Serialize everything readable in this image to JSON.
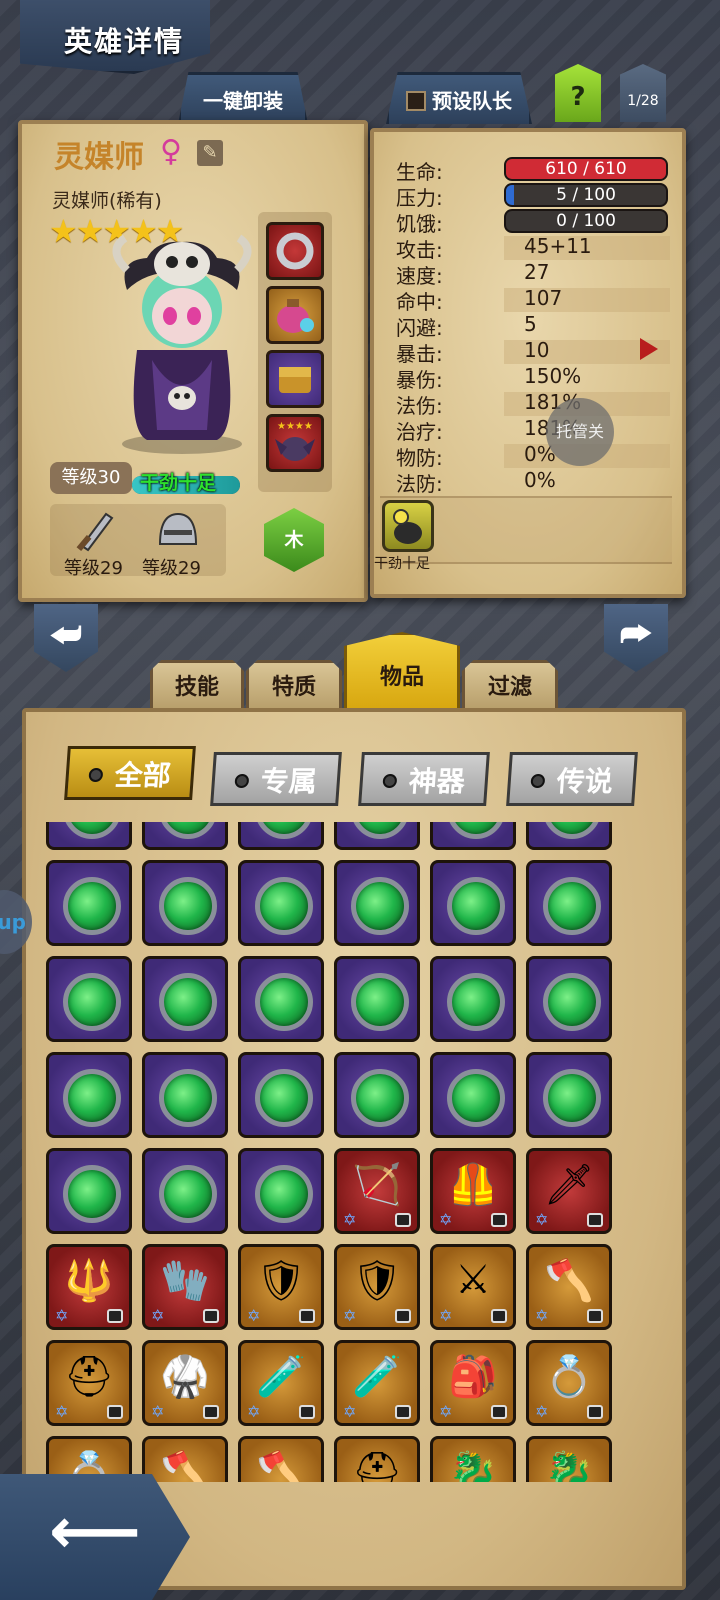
{
  "header": {
    "title": "英雄详情"
  },
  "top_tabs": {
    "unequip_all": "一键卸装",
    "preset_captain": "预设队长",
    "help": "?",
    "page_indicator": "1/28"
  },
  "hero": {
    "name": "灵媒师",
    "gender_symbol": "♀",
    "class": "灵媒师(稀有)",
    "stars": 5,
    "stars_text": "★★★★★",
    "level": "等级30",
    "mood": "干劲十足",
    "mood_level": 1.0,
    "weapon_level": "等级29",
    "armor_level": "等级29",
    "element": "木",
    "equipment_slots": [
      "ring",
      "potion-bag",
      "chest",
      "bat-pet"
    ]
  },
  "stats": {
    "hp_label": "生命:",
    "hp_value": "610 / 610",
    "hp_fraction": 1.0,
    "stress_label": "压力:",
    "stress_value": "5 / 100",
    "stress_fraction": 0.05,
    "hunger_label": "饥饿:",
    "hunger_value": "0 / 100",
    "hunger_fraction": 0.0,
    "rows": [
      {
        "label": "攻击:",
        "value": "45+11"
      },
      {
        "label": "速度:",
        "value": "27"
      },
      {
        "label": "命中:",
        "value": "107"
      },
      {
        "label": "闪避:",
        "value": "5"
      },
      {
        "label": "暴击:",
        "value": "10"
      },
      {
        "label": "暴伤:",
        "value": "150%"
      },
      {
        "label": "法伤:",
        "value": "181%"
      },
      {
        "label": "治疗:",
        "value": "181%"
      },
      {
        "label": "物防:",
        "value": "0%"
      },
      {
        "label": "法防:",
        "value": "0%"
      }
    ],
    "overlay_button": "托管关",
    "status_effect_label": "干劲十足"
  },
  "section_tabs": [
    "技能",
    "特质",
    "物品",
    "过滤"
  ],
  "active_section_tab": "物品",
  "filters": [
    "全部",
    "专属",
    "神器",
    "传说"
  ],
  "active_filter": "全部",
  "side_pill": "up",
  "inventory": {
    "rows": [
      [
        "gem",
        "gem",
        "gem",
        "gem",
        "gem",
        "gem"
      ],
      [
        "gem",
        "gem",
        "gem",
        "gem",
        "gem",
        "gem"
      ],
      [
        "gem",
        "gem",
        "gem",
        "gem",
        "gem",
        "gem"
      ],
      [
        "gem",
        "gem",
        "gem",
        "gem",
        "gem",
        "gem"
      ],
      [
        "gem",
        "gem",
        "gem",
        "red:crossbow",
        "red:chest-armor",
        "red:dagger"
      ],
      [
        "red:spear",
        "red:gloves",
        "gold:shield",
        "gold:shield",
        "gold:cross-blade",
        "gold:axe"
      ],
      [
        "gold:helmet",
        "gold:armor",
        "gold:flask",
        "gold:flask",
        "gold:bag",
        "gold:ring"
      ],
      [
        "gold:ring",
        "gold:axe",
        "gold:axe",
        "gold:helmet",
        "gold:trinket",
        "gold:trinket"
      ]
    ]
  },
  "colors": {
    "hp_bar": "#d02b35",
    "stress_bar": "#2f6bd1",
    "accent_gold": "#e6bf37",
    "parchment": "#dcc593"
  }
}
